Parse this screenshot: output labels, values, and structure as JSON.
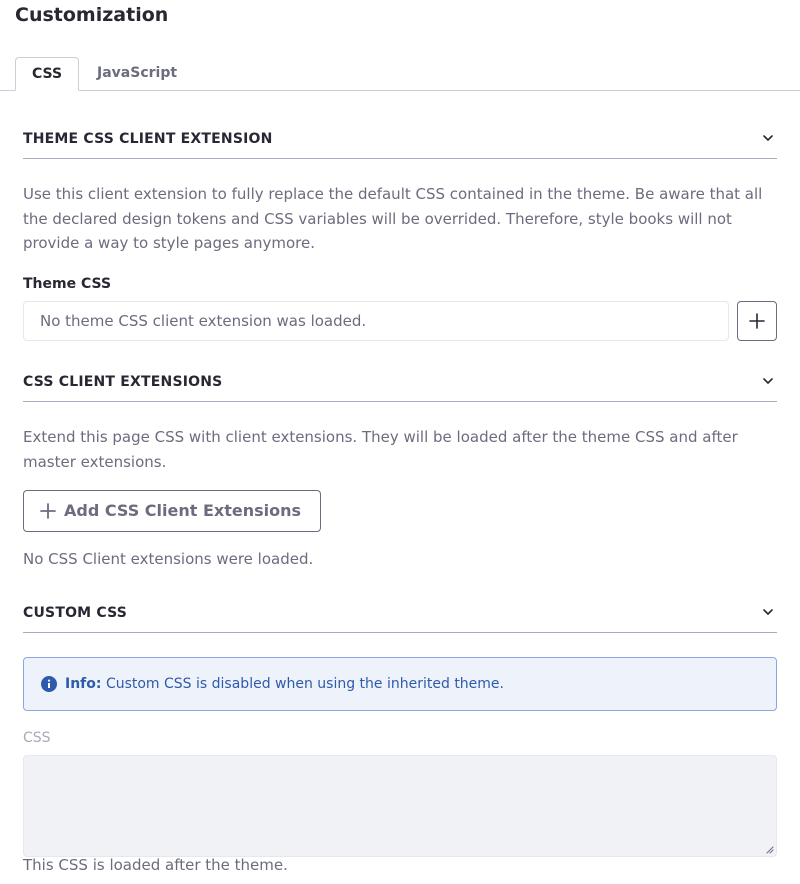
{
  "page": {
    "title": "Customization"
  },
  "tabs": [
    {
      "label": "CSS",
      "active": true
    },
    {
      "label": "JavaScript",
      "active": false
    }
  ],
  "theme_css_section": {
    "title": "THEME CSS CLIENT EXTENSION",
    "description": "Use this client extension to fully replace the default CSS contained in the theme. Be aware that all the declared design tokens and CSS variables will be overrided. Therefore, style books will not provide a way to style pages anymore.",
    "field_label": "Theme CSS",
    "field_value": "No theme CSS client extension was loaded."
  },
  "css_client_extensions_section": {
    "title": "CSS CLIENT EXTENSIONS",
    "description": "Extend this page CSS with client extensions. They will be loaded after the theme CSS and after master extensions.",
    "add_button_label": "Add CSS Client Extensions",
    "empty_message": "No CSS Client extensions were loaded."
  },
  "custom_css_section": {
    "title": "CUSTOM CSS",
    "info_strong": "Info:",
    "info_text": "Custom CSS is disabled when using the inherited theme.",
    "css_label": "CSS",
    "help_text": "This CSS is loaded after the theme."
  },
  "colors": {
    "primary_text": "#272833",
    "secondary_text": "#6b6c7e",
    "info_background": "#eef2fa",
    "info_border": "#89a7e0",
    "info_text": "#2e5aac",
    "disabled_field": "#f1f2f5"
  },
  "icons": {
    "collapse": "chevron-down-icon",
    "add": "plus-icon",
    "info": "info-circle-icon"
  }
}
